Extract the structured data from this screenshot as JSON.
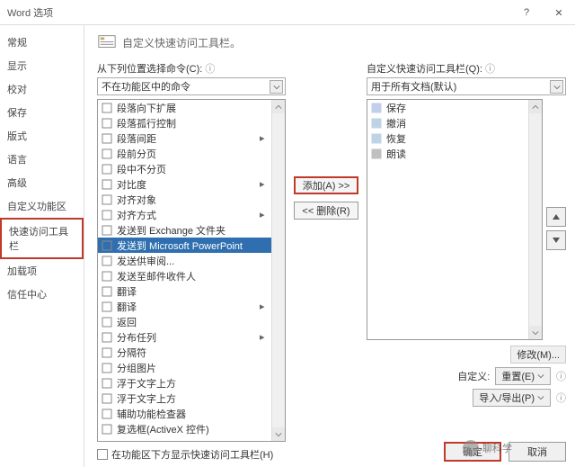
{
  "title": "Word 选项",
  "header": "自定义快速访问工具栏。",
  "sidebar": {
    "items": [
      "常规",
      "显示",
      "校对",
      "保存",
      "版式",
      "语言",
      "高级",
      "自定义功能区",
      "快速访问工具栏",
      "加载项",
      "信任中心"
    ],
    "selected": 8
  },
  "left": {
    "label": "从下列位置选择命令(C):",
    "combo": "不在功能区中的命令",
    "items": [
      {
        "t": "段落向下扩展"
      },
      {
        "t": "段落孤行控制"
      },
      {
        "t": "段落间距",
        "sub": true
      },
      {
        "t": "段前分页"
      },
      {
        "t": "段中不分页"
      },
      {
        "t": "对比度",
        "sub": true
      },
      {
        "t": "对齐对象"
      },
      {
        "t": "对齐方式",
        "sub": true
      },
      {
        "t": "发送到 Exchange 文件夹"
      },
      {
        "t": "发送到 Microsoft PowerPoint",
        "sel": true
      },
      {
        "t": "发送供审阅..."
      },
      {
        "t": "发送至邮件收件人"
      },
      {
        "t": "翻译"
      },
      {
        "t": "翻译",
        "sub": true
      },
      {
        "t": "返回"
      },
      {
        "t": "分布任列",
        "sub": true
      },
      {
        "t": "分隔符"
      },
      {
        "t": "分组图片"
      },
      {
        "t": "浮于文字上方"
      },
      {
        "t": "浮于文字上方"
      },
      {
        "t": "辅助功能检查器"
      },
      {
        "t": "复选框(ActiveX 控件)"
      }
    ]
  },
  "mid": {
    "add": "添加(A) >>",
    "remove": "<< 删除(R)"
  },
  "right": {
    "label": "自定义快速访问工具栏(Q):",
    "combo": "用于所有文档(默认)",
    "items": [
      {
        "t": "保存",
        "c": "#3b5fc4"
      },
      {
        "t": "撤消",
        "c": "#2f6fb0"
      },
      {
        "t": "恢复",
        "c": "#2f6fb0"
      },
      {
        "t": "朗读",
        "c": "#333"
      }
    ],
    "modify": "修改(M)...",
    "custom_label": "自定义:",
    "reset": "重置(E)",
    "importexport": "导入/导出(P)"
  },
  "checkbox": "在功能区下方显示快速访问工具栏(H)",
  "footer": {
    "ok": "确定",
    "cancel": "取消"
  },
  "watermark": "聊科学"
}
